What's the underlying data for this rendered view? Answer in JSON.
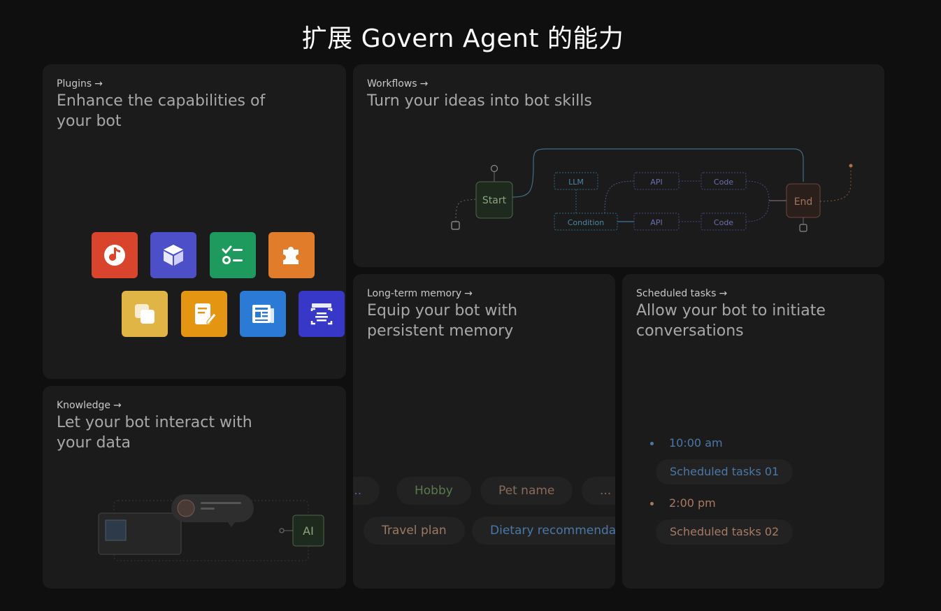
{
  "page": {
    "title": "扩展 Govern Agent 的能力"
  },
  "cards": {
    "plugins": {
      "kicker": "Plugins",
      "arrow": "→",
      "headline": "Enhance the capabilities of your bot"
    },
    "workflows": {
      "kicker": "Workflows",
      "arrow": "→",
      "headline": "Turn your ideas into bot skills"
    },
    "memory": {
      "kicker": "Long-term memory",
      "arrow": "→",
      "headline": "Equip your bot with persistent memory"
    },
    "scheduled": {
      "kicker": "Scheduled tasks",
      "arrow": "→",
      "headline": "Allow your bot to initiate conversations"
    },
    "knowledge": {
      "kicker": "Knowledge",
      "arrow": "→",
      "headline": "Let your bot interact with your data"
    }
  },
  "plugin_icons": [
    {
      "name": "music-note-icon",
      "color": "#d9442c"
    },
    {
      "name": "cube-icon",
      "color": "#4d4fc9"
    },
    {
      "name": "checklist-icon",
      "color": "#1e9a5e"
    },
    {
      "name": "puzzle-piece-icon",
      "color": "#e07c2a"
    },
    {
      "name": "overlapping-squares-icon",
      "color": "#e0b445"
    },
    {
      "name": "document-edit-icon",
      "color": "#e49512"
    },
    {
      "name": "newspaper-icon",
      "color": "#2a7ad6"
    },
    {
      "name": "scan-document-icon",
      "color": "#3838c8"
    }
  ],
  "workflow": {
    "nodes": {
      "start": "Start",
      "end": "End",
      "llm": "LLM",
      "condition": "Condition",
      "api_top": "API",
      "api_bottom": "API",
      "code_top": "Code",
      "code_bottom": "Code"
    }
  },
  "memory": {
    "chips_row1": [
      {
        "label": "...",
        "color": "#4b6a9a"
      },
      {
        "label": "Hobby",
        "color": "#5b7a4a"
      },
      {
        "label": "Pet name",
        "color": "#8a6a58"
      },
      {
        "label": "...",
        "color": "#8a6a58"
      }
    ],
    "chips_row2": [
      {
        "label": "Travel plan",
        "color": "#9a7a62"
      },
      {
        "label": "Dietary recommendations",
        "color": "#4a78a8"
      }
    ]
  },
  "scheduled": {
    "tasks": [
      {
        "time": "10:00 am",
        "label": "Scheduled tasks 01",
        "color": "#4a78a8"
      },
      {
        "time": "2:00 pm",
        "label": "Scheduled tasks 02",
        "color": "#a87a62"
      }
    ]
  },
  "knowledge": {
    "ai_label": "AI"
  }
}
